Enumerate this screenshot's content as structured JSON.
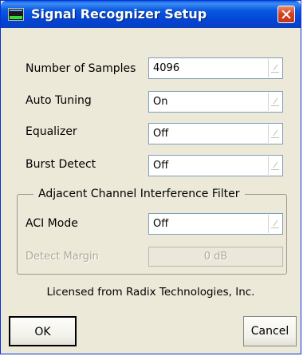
{
  "window": {
    "title": "Signal Recognizer Setup"
  },
  "fields": [
    {
      "label": "Number of Samples",
      "value": "4096"
    },
    {
      "label": "Auto Tuning",
      "value": "On"
    },
    {
      "label": "Equalizer",
      "value": "Off"
    },
    {
      "label": "Burst Detect",
      "value": "Off"
    }
  ],
  "aci_group": {
    "title": "Adjacent Channel Interference Filter",
    "mode_label": "ACI Mode",
    "mode_value": "Off",
    "margin_label": "Detect Margin",
    "margin_value": "0 dB"
  },
  "license_text": "Licensed from Radix Technologies, Inc.",
  "buttons": {
    "ok": "OK",
    "cancel": "Cancel"
  },
  "colors": {
    "titlebar": "#0a59e0",
    "dialog_bg": "#ece9d8",
    "disabled_text": "#aca899"
  },
  "icons": {
    "app": "signal-spectrum-icon",
    "close": "close-icon",
    "dropdown": "dropdown-arrow-icon"
  }
}
